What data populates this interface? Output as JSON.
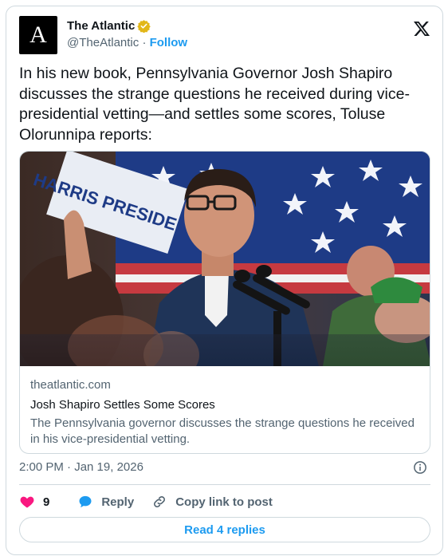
{
  "colors": {
    "accent": "#1d9bf0",
    "like": "#f91880",
    "verified_gold": "#e2b719",
    "text": "#0f1419",
    "muted": "#536471",
    "border": "#cfd9de"
  },
  "author": {
    "avatar_letter": "A",
    "name": "The Atlantic",
    "handle": "@TheAtlantic",
    "separator": "·",
    "follow_label": "Follow"
  },
  "tweet": {
    "text": "In his new book, Pennsylvania Governor Josh Shapiro discusses the strange questions he received during vice-presidential vetting—and settles some scores, Toluse Olorunnipa reports:"
  },
  "link_card": {
    "sign_text": "HARRIS PRESIDENT",
    "domain": "theatlantic.com",
    "title": "Josh Shapiro Settles Some Scores",
    "description": "The Pennsylvania governor discusses the strange questions he received in his vice-presidential vetting."
  },
  "timestamp": "2:00 PM · Jan 19, 2026",
  "actions": {
    "like_count": "9",
    "reply_label": "Reply",
    "copy_label": "Copy link to post"
  },
  "read_replies_label": "Read 4 replies"
}
